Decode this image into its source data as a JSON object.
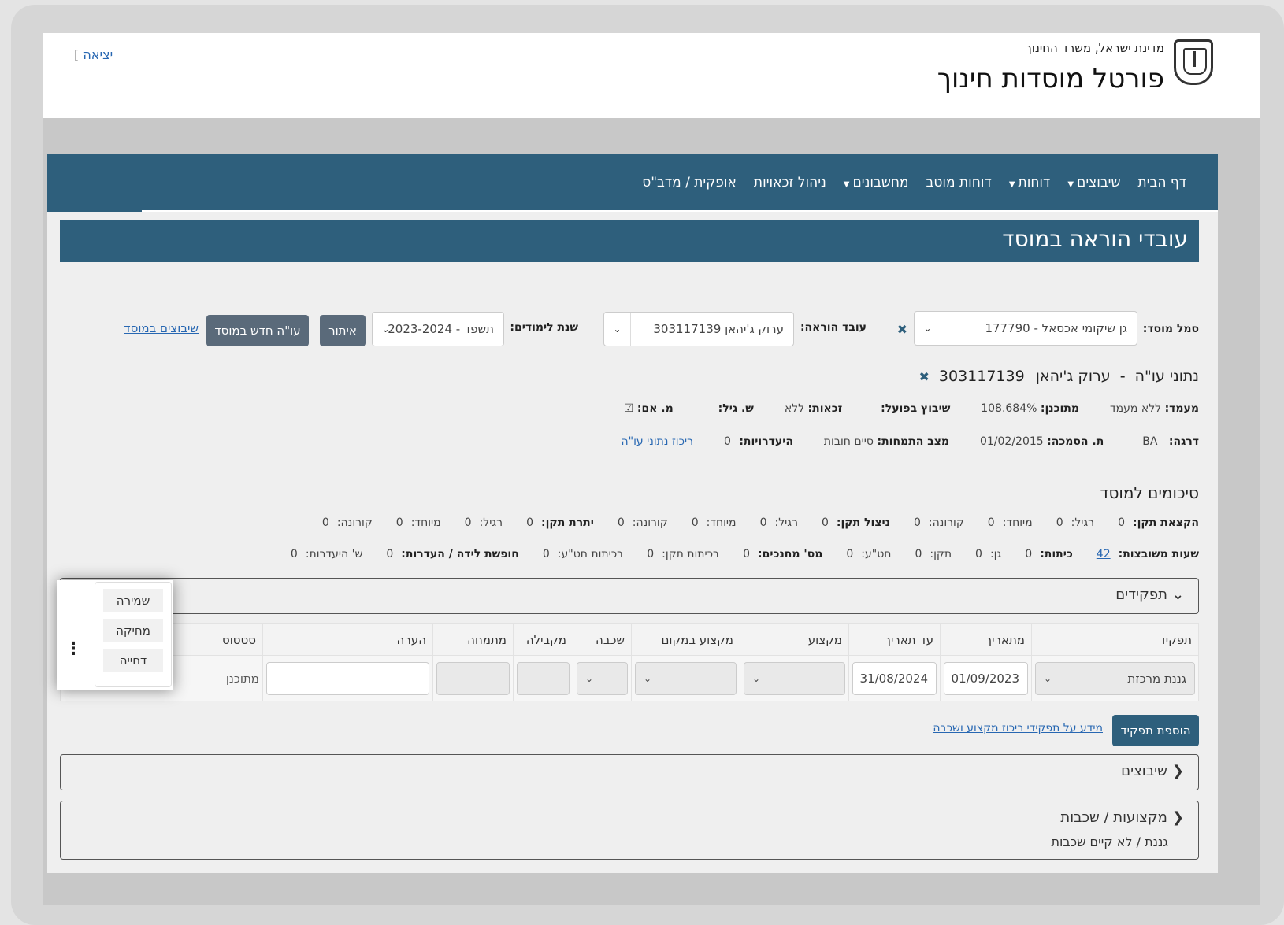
{
  "header": {
    "ministry": "מדינת ישראל, משרד החינוך",
    "portal_title": "פורטל מוסדות חינוך",
    "logout": "יציאה",
    "logout_bracket": "]"
  },
  "nav": [
    {
      "label": "דף הבית",
      "dropdown": false
    },
    {
      "label": "שיבוצים",
      "dropdown": true
    },
    {
      "label": "דוחות",
      "dropdown": true
    },
    {
      "label": "דוחות מוטב",
      "dropdown": false
    },
    {
      "label": "מחשבונים",
      "dropdown": true
    },
    {
      "label": "ניהול זכאויות",
      "dropdown": false
    },
    {
      "label": "אופקית / מדב\"ס",
      "dropdown": false
    }
  ],
  "page_title": "עובדי הוראה במוסד",
  "filters": {
    "institution_label": "סמל מוסד:",
    "institution_value": "גן שיקומי אכסאל - 177790",
    "teacher_label": "עובד הוראה:",
    "teacher_value": "ערוק ג'יהאן 303117139",
    "year_label": "שנת לימודים:",
    "year_value": "תשפד - 2023-2024",
    "search_button": "איתור",
    "new_teacher_button": "עו\"ה חדש במוסד",
    "placements_link": "שיבוצים במוסד"
  },
  "teacher": {
    "title_prefix": "נתוני עו\"ה",
    "title_sep": "-",
    "name": "ערוק ג'יהאן",
    "id": "303117139",
    "status_label": "מעמד:",
    "status_value": "ללא מעמד",
    "planned_label": "מתוכנן:",
    "planned_value": "108.684%",
    "actual_label": "שיבוץ בפועל:",
    "entitlements_label": "זכאות:",
    "entitlements_value": "ללא",
    "age_label": "ש. גיל:",
    "ma_label": "מ. אם:",
    "ma_check": "☑",
    "rank_label": "דרגה:",
    "rank_value": "BA",
    "cert_label": "ת. הסמכה:",
    "cert_value": "01/02/2015",
    "spec_label": "מצב התמחות:",
    "spec_value": "סיים חובות",
    "absence_label": "היעדרויות:",
    "absence_value": "0",
    "summary_link": "ריכוז נתוני עו\"ה"
  },
  "summaries": {
    "title": "סיכומים למוסד",
    "row1": [
      {
        "label": "הקצאת תקן:",
        "bold": true,
        "value": "0"
      },
      {
        "label": "רגיל:",
        "bold": false,
        "value": "0"
      },
      {
        "label": "מיוחד:",
        "bold": false,
        "value": "0"
      },
      {
        "label": "קורונה:",
        "bold": false,
        "value": "0"
      },
      {
        "label": "ניצול תקן:",
        "bold": true,
        "value": "0"
      },
      {
        "label": "רגיל:",
        "bold": false,
        "value": "0"
      },
      {
        "label": "מיוחד:",
        "bold": false,
        "value": "0"
      },
      {
        "label": "קורונה:",
        "bold": false,
        "value": "0"
      },
      {
        "label": "יתרת תקן:",
        "bold": true,
        "value": "0"
      },
      {
        "label": "רגיל:",
        "bold": false,
        "value": "0"
      },
      {
        "label": "מיוחד:",
        "bold": false,
        "value": "0"
      },
      {
        "label": "קורונה:",
        "bold": false,
        "value": "0"
      }
    ],
    "row2": [
      {
        "label": "שעות משובצות:",
        "bold": true,
        "value": "42",
        "link": true
      },
      {
        "label": "כיתות:",
        "bold": true,
        "value": "0"
      },
      {
        "label": "גן:",
        "bold": false,
        "value": "0"
      },
      {
        "label": "תקן:",
        "bold": false,
        "value": "0"
      },
      {
        "label": "חט\"ע:",
        "bold": false,
        "value": "0"
      },
      {
        "label": "מס' מחנכים:",
        "bold": true,
        "value": "0"
      },
      {
        "label": "בכיתות תקן:",
        "bold": false,
        "value": "0"
      },
      {
        "label": "בכיתות חט\"ע:",
        "bold": false,
        "value": "0"
      },
      {
        "label": "חופשת לידה / העדרות:",
        "bold": true,
        "value": "0"
      },
      {
        "label": "ש' היעדרות:",
        "bold": false,
        "value": "0"
      }
    ]
  },
  "roles_section": {
    "title": "תפקידים",
    "columns": [
      "תפקיד",
      "מתאריך",
      "עד תאריך",
      "מקצוע",
      "מקצוע במקום",
      "שכבה",
      "מקבילה",
      "מתמחה",
      "הערה",
      "סטטוס"
    ],
    "row": {
      "role": "גננת מרכזת",
      "from_date": "01/09/2023",
      "to_date": "31/08/2024",
      "status": "מתוכנן"
    },
    "add_button": "הוספת תפקיד",
    "info_link": "מידע על תפקידי ריכוז מקצוע ושכבה"
  },
  "row_menu": [
    "שמירה",
    "מחיקה",
    "דחייה"
  ],
  "placements_section": {
    "title": "שיבוצים"
  },
  "subjects_section": {
    "title": "מקצועות / שכבות",
    "text": "גננת / לא קיים שכבות"
  }
}
